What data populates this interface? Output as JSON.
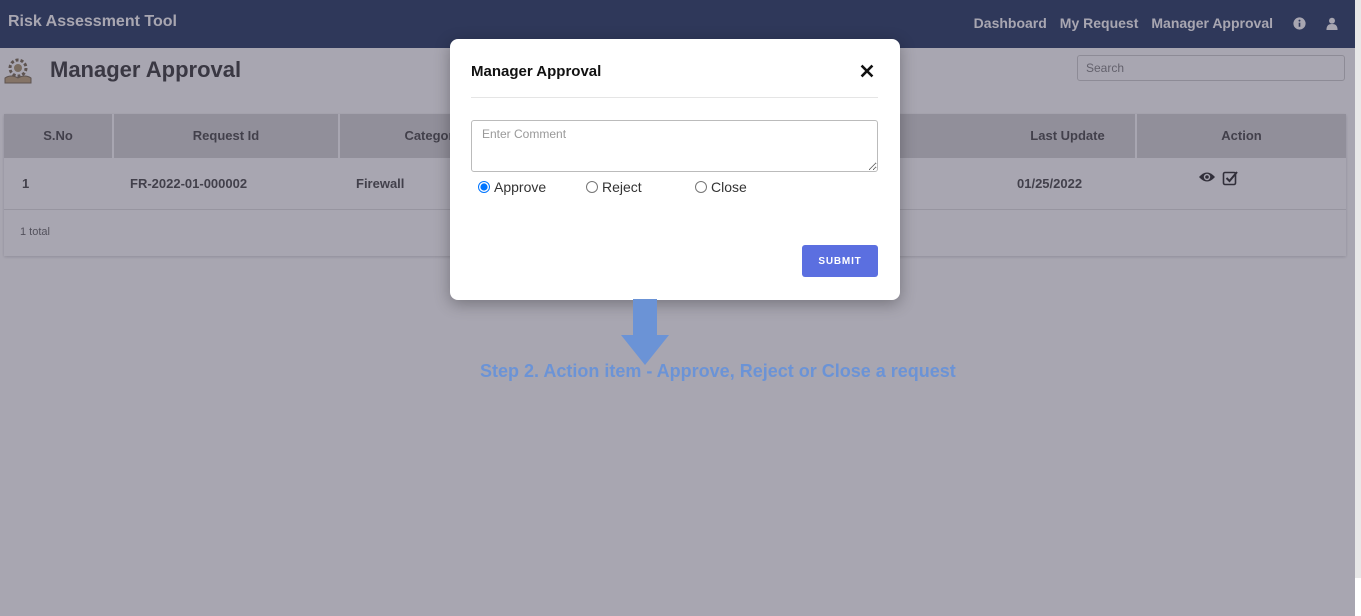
{
  "navbar": {
    "brand": "Risk Assessment Tool",
    "links": [
      "Dashboard",
      "My Request",
      "Manager Approval"
    ],
    "info_icon": "info-circle-icon",
    "user_icon": "user-icon"
  },
  "page": {
    "title": "Manager Approval",
    "logo_icon": "gear-hands-icon",
    "search_placeholder": "Search"
  },
  "table": {
    "columns": [
      "S.No",
      "Request Id",
      "Categor",
      "Last Update",
      "Action"
    ],
    "rows": [
      {
        "sno": "1",
        "request_id": "FR-2022-01-000002",
        "category": "Firewall",
        "last_update": "01/25/2022"
      }
    ],
    "total": "1 total",
    "action_icons": [
      "eye-icon",
      "check-square-icon"
    ]
  },
  "modal": {
    "title": "Manager Approval",
    "comment_placeholder": "Enter Comment",
    "options": [
      "Approve",
      "Reject",
      "Close"
    ],
    "selected": "Approve",
    "submit_label": "SUBMIT",
    "close_icon": "close-icon"
  },
  "annotation": {
    "text": "Step 2. Action item - Approve, Reject or Close a request",
    "color": "#6b93d6",
    "arrow_icon": "down-arrow-icon"
  },
  "colors": {
    "navbar": "#0d2350",
    "submit": "#5b6fe0",
    "table_header": "#d0d0d0"
  }
}
